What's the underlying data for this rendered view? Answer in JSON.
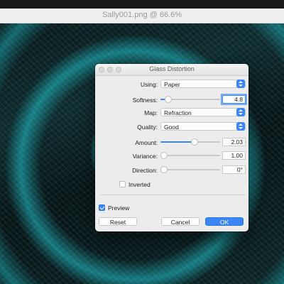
{
  "window": {
    "title": "Sally001.png @ 66.6%"
  },
  "dialog": {
    "title": "Glass Distortion",
    "using": {
      "label": "Using:",
      "value": "Paper"
    },
    "softness": {
      "label": "Softness:",
      "value": "4.8",
      "level": 0.08
    },
    "map": {
      "label": "Map:",
      "value": "Refraction"
    },
    "quality": {
      "label": "Quality:",
      "value": "Good"
    },
    "amount": {
      "label": "Amount:",
      "value": "2.03",
      "level": 0.58
    },
    "variance": {
      "label": "Variance:",
      "value": "1.00",
      "level": 0.0
    },
    "direction": {
      "label": "Direction:",
      "value": "0°",
      "level": 0.0
    },
    "inverted": {
      "label": "Inverted",
      "checked": false
    },
    "preview": {
      "label": "Preview",
      "checked": true
    },
    "buttons": {
      "reset": "Reset",
      "cancel": "Cancel",
      "ok": "OK"
    }
  },
  "colors": {
    "accent": "#3a86f7",
    "canvas_cyan": "#2ad0d6"
  },
  "icons": {
    "close": "close-icon",
    "minimize": "minimize-icon",
    "zoom": "zoom-icon",
    "select_caret": "chevron-updown-icon"
  }
}
